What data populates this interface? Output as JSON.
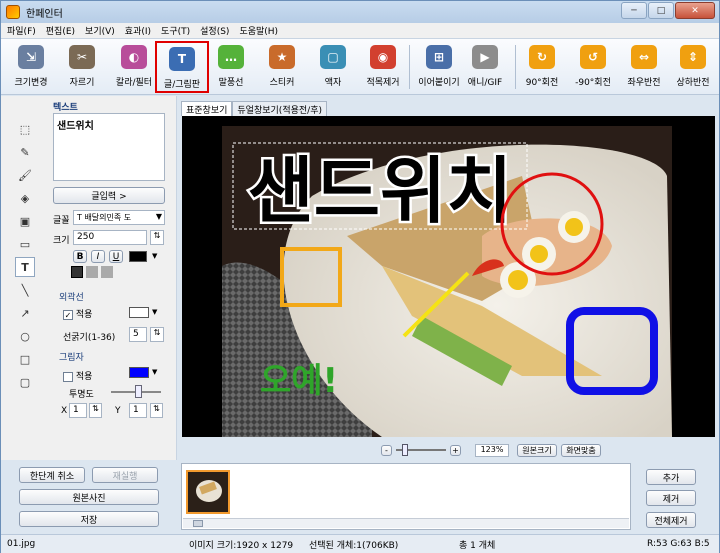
{
  "title": "한페인터",
  "window_controls": {
    "minimize": "─",
    "maximize": "□",
    "close": "✕"
  },
  "menu": [
    "파일(F)",
    "편집(E)",
    "보기(V)",
    "효과(I)",
    "도구(T)",
    "설정(S)",
    "도움말(H)"
  ],
  "toolbar": [
    {
      "label": "크기변경",
      "icon": "resize-icon",
      "color": "#6a7fa0"
    },
    {
      "label": "자르기",
      "icon": "crop-icon",
      "color": "#7b6a55"
    },
    {
      "label": "칼라/필터",
      "icon": "color-filter-icon",
      "color": "#b84d9a"
    },
    {
      "label": "글/그림판",
      "icon": "text-draw-icon",
      "color": "#3b6db3",
      "active": true
    },
    {
      "label": "말풍선",
      "icon": "speech-bubble-icon",
      "color": "#55b23a"
    },
    {
      "label": "스티커",
      "icon": "sticker-icon",
      "color": "#c96b2b"
    },
    {
      "label": "액자",
      "icon": "frame-icon",
      "color": "#3a8fb5"
    },
    {
      "label": "적목제거",
      "icon": "red-eye-icon",
      "color": "#d2402f"
    },
    {
      "label": "이어붙이기",
      "icon": "merge-icon",
      "color": "#4a6fa8"
    },
    {
      "label": "애니/GIF",
      "icon": "gif-icon",
      "color": "#8c8c8c"
    },
    {
      "label": "90°회전",
      "icon": "rotate-cw-icon",
      "color": "#f0a010"
    },
    {
      "label": "-90°회전",
      "icon": "rotate-ccw-icon",
      "color": "#f0a010"
    },
    {
      "label": "좌우반전",
      "icon": "flip-h-icon",
      "color": "#f0a010"
    },
    {
      "label": "상하반전",
      "icon": "flip-v-icon",
      "color": "#f0a010"
    }
  ],
  "panel": {
    "text_section": "텍스트",
    "text_value": "샌드위치",
    "input_button": "글입력 >",
    "font_label": "글꼴",
    "font_value": "배달의민족 도",
    "size_label": "크기",
    "size_value": "250",
    "bold": "B",
    "italic": "I",
    "underline": "U",
    "outline_section": "외곽선",
    "outline_apply": "적용",
    "outline_thickness_label": "선굵기(1-36)",
    "outline_thickness_value": "5",
    "shadow_section": "그림자",
    "shadow_apply": "적용",
    "opacity_label": "투명도",
    "x_label": "X",
    "x_value": "1",
    "y_label": "Y",
    "y_value": "1",
    "text_color": "#000000",
    "outline_color": "#ffffff",
    "shadow_color": "#0000ff"
  },
  "tools": [
    "select-icon",
    "pencil-icon",
    "brush-icon",
    "fill-icon",
    "stamp-icon",
    "eraser-icon",
    "text-tool-icon",
    "line-icon",
    "arrow-icon",
    "ellipse-icon",
    "rectangle-icon",
    "rounded-rect-icon"
  ],
  "bottom_left": {
    "undo": "한단계 취소",
    "redo": "재실행",
    "original": "원본사진",
    "save": "저장"
  },
  "tabs": [
    "표준창보기",
    "듀얼창보기(적용전/후)"
  ],
  "canvas": {
    "headline": "샌드위치",
    "signature": "오예!"
  },
  "zoom": {
    "value": "123%",
    "original_size": "원본크기",
    "fit": "화면맞춤",
    "minus": "-",
    "plus": "+"
  },
  "right_buttons": {
    "add": "추가",
    "remove": "제거",
    "remove_all": "전체제거"
  },
  "status": {
    "file": "01.jpg",
    "image_size": "이미지 크기:1920 x 1279",
    "selected": "선택된 개체:1(706KB)",
    "total": "총 1 개체",
    "rgb": "R:53 G:63 B:5"
  }
}
